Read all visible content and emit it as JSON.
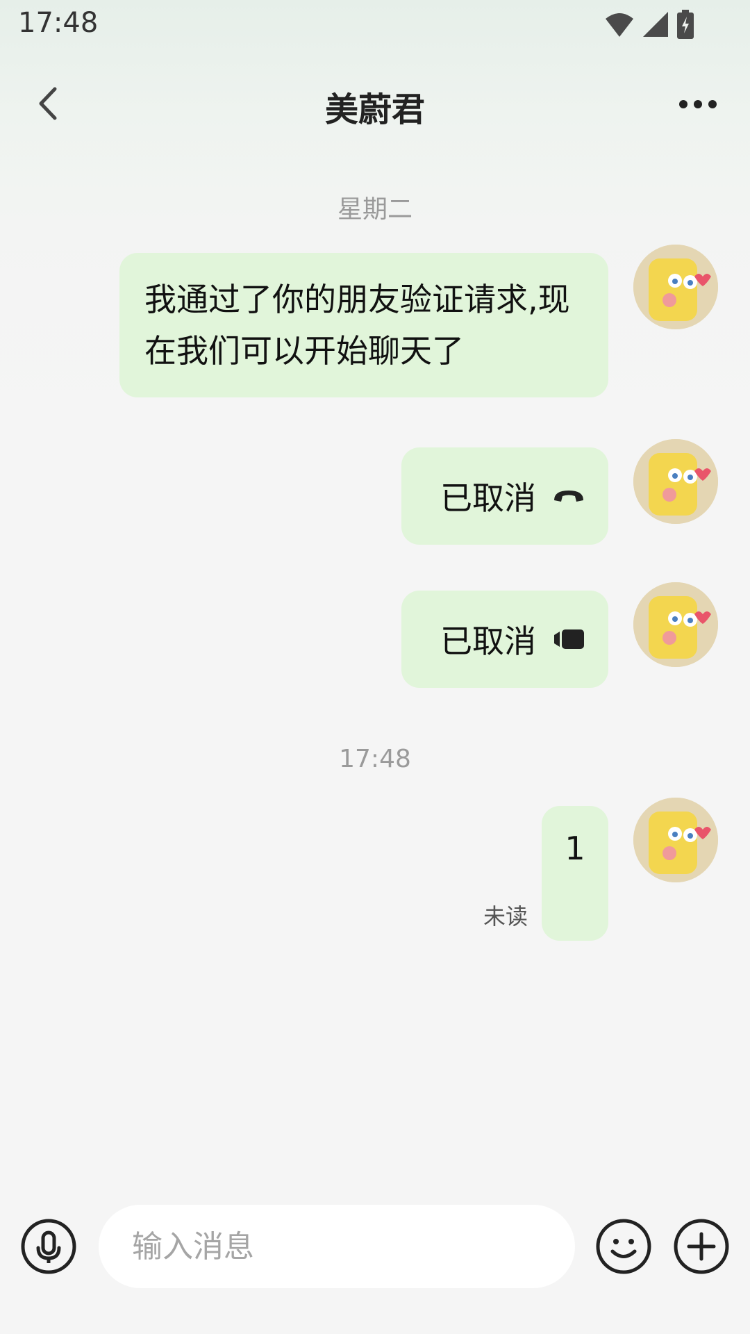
{
  "status_bar": {
    "time": "17:48",
    "icons": [
      "wifi-icon",
      "cellular-signal-icon",
      "battery-charging-icon"
    ]
  },
  "header": {
    "title": "美蔚君",
    "back_icon": "chevron-left-icon",
    "more_icon": "more-horizontal-icon"
  },
  "messages": [
    {
      "type": "divider",
      "text": "星期二"
    },
    {
      "type": "text",
      "sender": "self",
      "text": "我通过了你的朋友验证请求,现在我们可以开始聊天了"
    },
    {
      "type": "call",
      "sender": "self",
      "call_kind": "voice",
      "text": "已取消",
      "icon": "phone-hangup-icon"
    },
    {
      "type": "call",
      "sender": "self",
      "call_kind": "video",
      "text": "已取消",
      "icon": "video-camera-icon"
    },
    {
      "type": "divider",
      "text": "17:48"
    },
    {
      "type": "text",
      "sender": "self",
      "text": "1",
      "status": "未读"
    }
  ],
  "input_bar": {
    "placeholder": "输入消息",
    "value": "",
    "left_icon": "microphone-icon",
    "emoji_icon": "emoji-icon",
    "plus_icon": "plus-circle-icon"
  },
  "colors": {
    "bubble_self": "#e1f5da",
    "background": "#f5f5f5",
    "divider_text": "#9a9a9a"
  }
}
